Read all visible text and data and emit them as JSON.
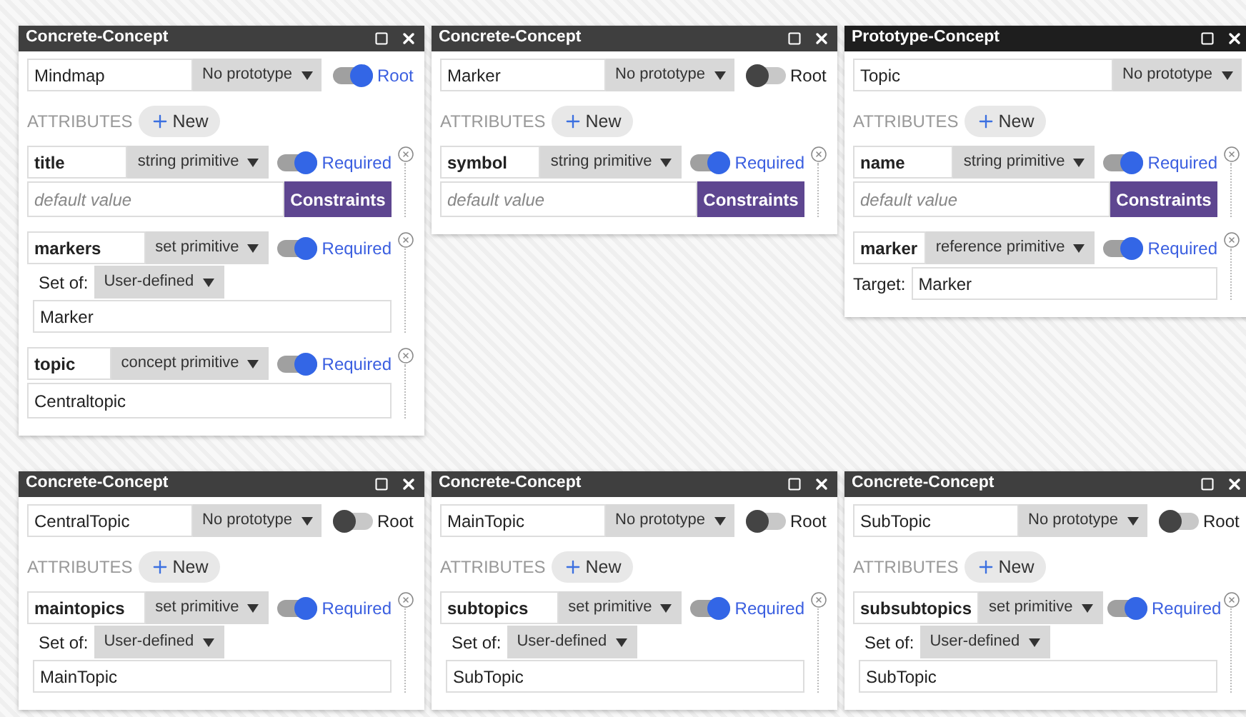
{
  "windows": [
    {
      "title": "Concrete-Concept",
      "active": false,
      "name": "Mindmap",
      "prototype": "No prototype",
      "root": {
        "label": "Root",
        "on": true
      },
      "attributes_label": "ATTRIBUTES",
      "new_button": "New",
      "attributes": [
        {
          "kind": "string",
          "name": "title",
          "type": "string primitive",
          "required_label": "Required",
          "required": true,
          "placeholder": "default value",
          "constraints_button": "Constraints"
        },
        {
          "kind": "set",
          "name": "markers",
          "type": "set primitive",
          "required_label": "Required",
          "required": true,
          "set_label": "Set of:",
          "set_type": "User-defined",
          "value": "Marker"
        },
        {
          "kind": "concept",
          "name": "topic",
          "type": "concept primitive",
          "required_label": "Required",
          "required": true,
          "value": "Centraltopic"
        }
      ]
    },
    {
      "title": "Concrete-Concept",
      "active": false,
      "name": "Marker",
      "prototype": "No prototype",
      "root": {
        "label": "Root",
        "on": false
      },
      "attributes_label": "ATTRIBUTES",
      "new_button": "New",
      "attributes": [
        {
          "kind": "string",
          "name": "symbol",
          "type": "string primitive",
          "required_label": "Required",
          "required": true,
          "placeholder": "default value",
          "constraints_button": "Constraints"
        }
      ]
    },
    {
      "title": "Prototype-Concept",
      "active": true,
      "name": "Topic",
      "prototype": "No prototype",
      "attributes_label": "ATTRIBUTES",
      "new_button": "New",
      "attributes": [
        {
          "kind": "string",
          "name": "name",
          "type": "string primitive",
          "required_label": "Required",
          "required": true,
          "placeholder": "default value",
          "constraints_button": "Constraints"
        },
        {
          "kind": "reference",
          "name": "marker",
          "type": "reference primitive",
          "required_label": "Required",
          "required": true,
          "target_label": "Target:",
          "value": "Marker"
        }
      ]
    },
    {
      "title": "Concrete-Concept",
      "active": false,
      "name": "CentralTopic",
      "prototype": "No prototype",
      "root": {
        "label": "Root",
        "on": false
      },
      "attributes_label": "ATTRIBUTES",
      "new_button": "New",
      "attributes": [
        {
          "kind": "set",
          "name": "maintopics",
          "type": "set primitive",
          "required_label": "Required",
          "required": true,
          "set_label": "Set of:",
          "set_type": "User-defined",
          "value": "MainTopic"
        }
      ]
    },
    {
      "title": "Concrete-Concept",
      "active": false,
      "name": "MainTopic",
      "prototype": "No prototype",
      "root": {
        "label": "Root",
        "on": false
      },
      "attributes_label": "ATTRIBUTES",
      "new_button": "New",
      "attributes": [
        {
          "kind": "set",
          "name": "subtopics",
          "type": "set primitive",
          "required_label": "Required",
          "required": true,
          "set_label": "Set of:",
          "set_type": "User-defined",
          "value": "SubTopic"
        }
      ]
    },
    {
      "title": "Concrete-Concept",
      "active": false,
      "name": "SubTopic",
      "prototype": "No prototype",
      "root": {
        "label": "Root",
        "on": false
      },
      "attributes_label": "ATTRIBUTES",
      "new_button": "New",
      "attributes": [
        {
          "kind": "set",
          "name": "subsubtopics",
          "type": "set primitive",
          "required_label": "Required",
          "required": true,
          "set_label": "Set of:",
          "set_type": "User-defined",
          "value": "SubTopic"
        }
      ]
    }
  ]
}
